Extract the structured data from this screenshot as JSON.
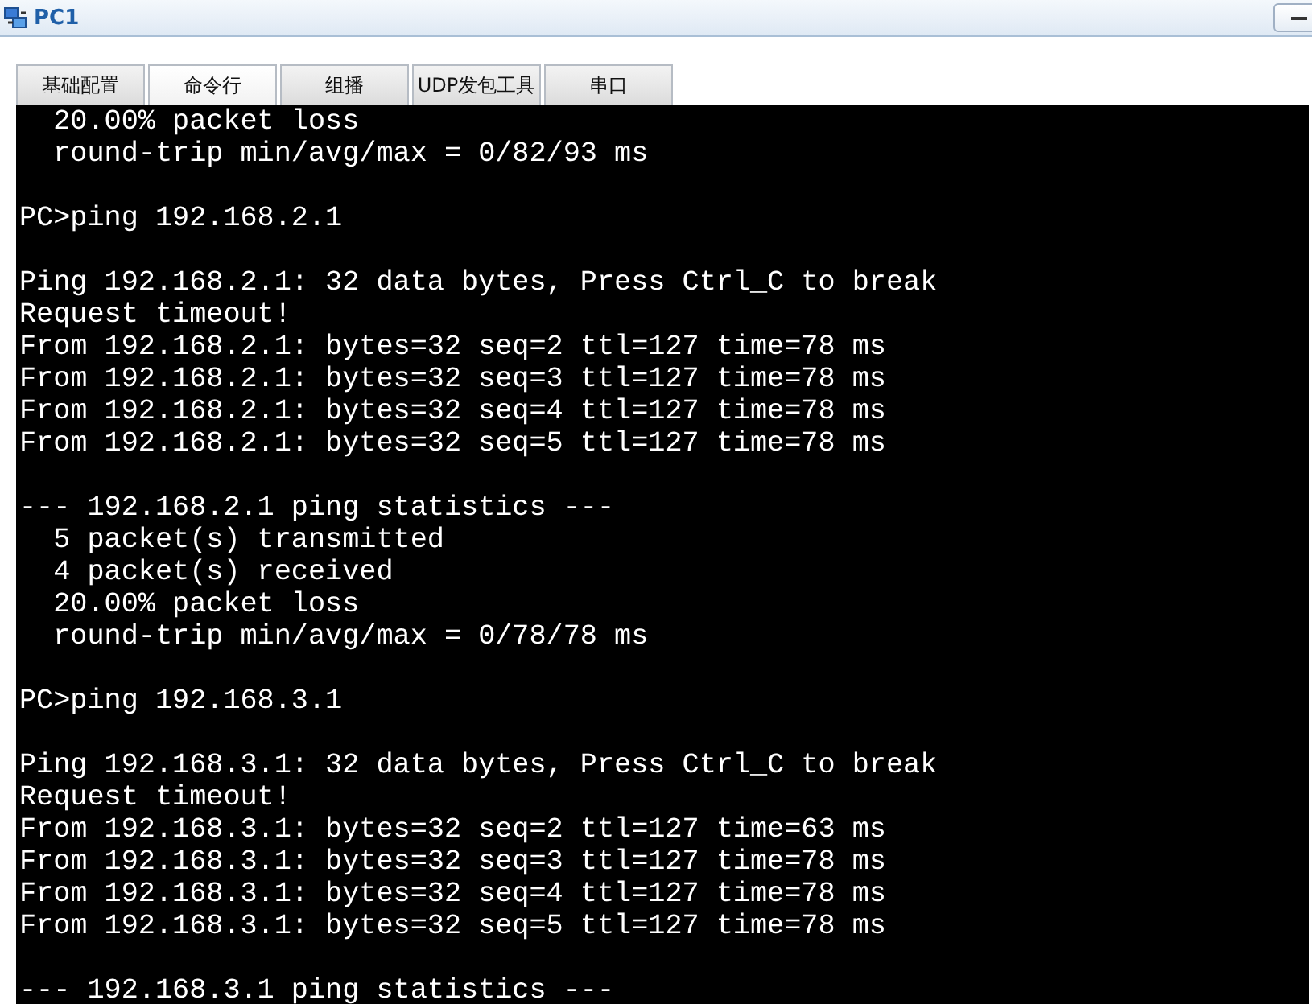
{
  "window": {
    "title": "PC1"
  },
  "tabs": [
    {
      "label": "基础配置",
      "selected": false
    },
    {
      "label": "命令行",
      "selected": true
    },
    {
      "label": "组播",
      "selected": false
    },
    {
      "label": "UDP发包工具",
      "selected": false
    },
    {
      "label": "串口",
      "selected": false
    }
  ],
  "terminal": {
    "blocks": [
      [
        "  20.00% packet loss",
        "  round-trip min/avg/max = 0/82/93 ms"
      ],
      [
        "PC>ping 192.168.2.1"
      ],
      [
        "Ping 192.168.2.1: 32 data bytes, Press Ctrl_C to break",
        "Request timeout!",
        "From 192.168.2.1: bytes=32 seq=2 ttl=127 time=78 ms",
        "From 192.168.2.1: bytes=32 seq=3 ttl=127 time=78 ms",
        "From 192.168.2.1: bytes=32 seq=4 ttl=127 time=78 ms",
        "From 192.168.2.1: bytes=32 seq=5 ttl=127 time=78 ms"
      ],
      [
        "--- 192.168.2.1 ping statistics ---",
        "  5 packet(s) transmitted",
        "  4 packet(s) received",
        "  20.00% packet loss",
        "  round-trip min/avg/max = 0/78/78 ms"
      ],
      [
        "PC>ping 192.168.3.1"
      ],
      [
        "Ping 192.168.3.1: 32 data bytes, Press Ctrl_C to break",
        "Request timeout!",
        "From 192.168.3.1: bytes=32 seq=2 ttl=127 time=63 ms",
        "From 192.168.3.1: bytes=32 seq=3 ttl=127 time=78 ms",
        "From 192.168.3.1: bytes=32 seq=4 ttl=127 time=78 ms",
        "From 192.168.3.1: bytes=32 seq=5 ttl=127 time=78 ms"
      ],
      [
        "--- 192.168.3.1 ping statistics ---"
      ]
    ]
  }
}
